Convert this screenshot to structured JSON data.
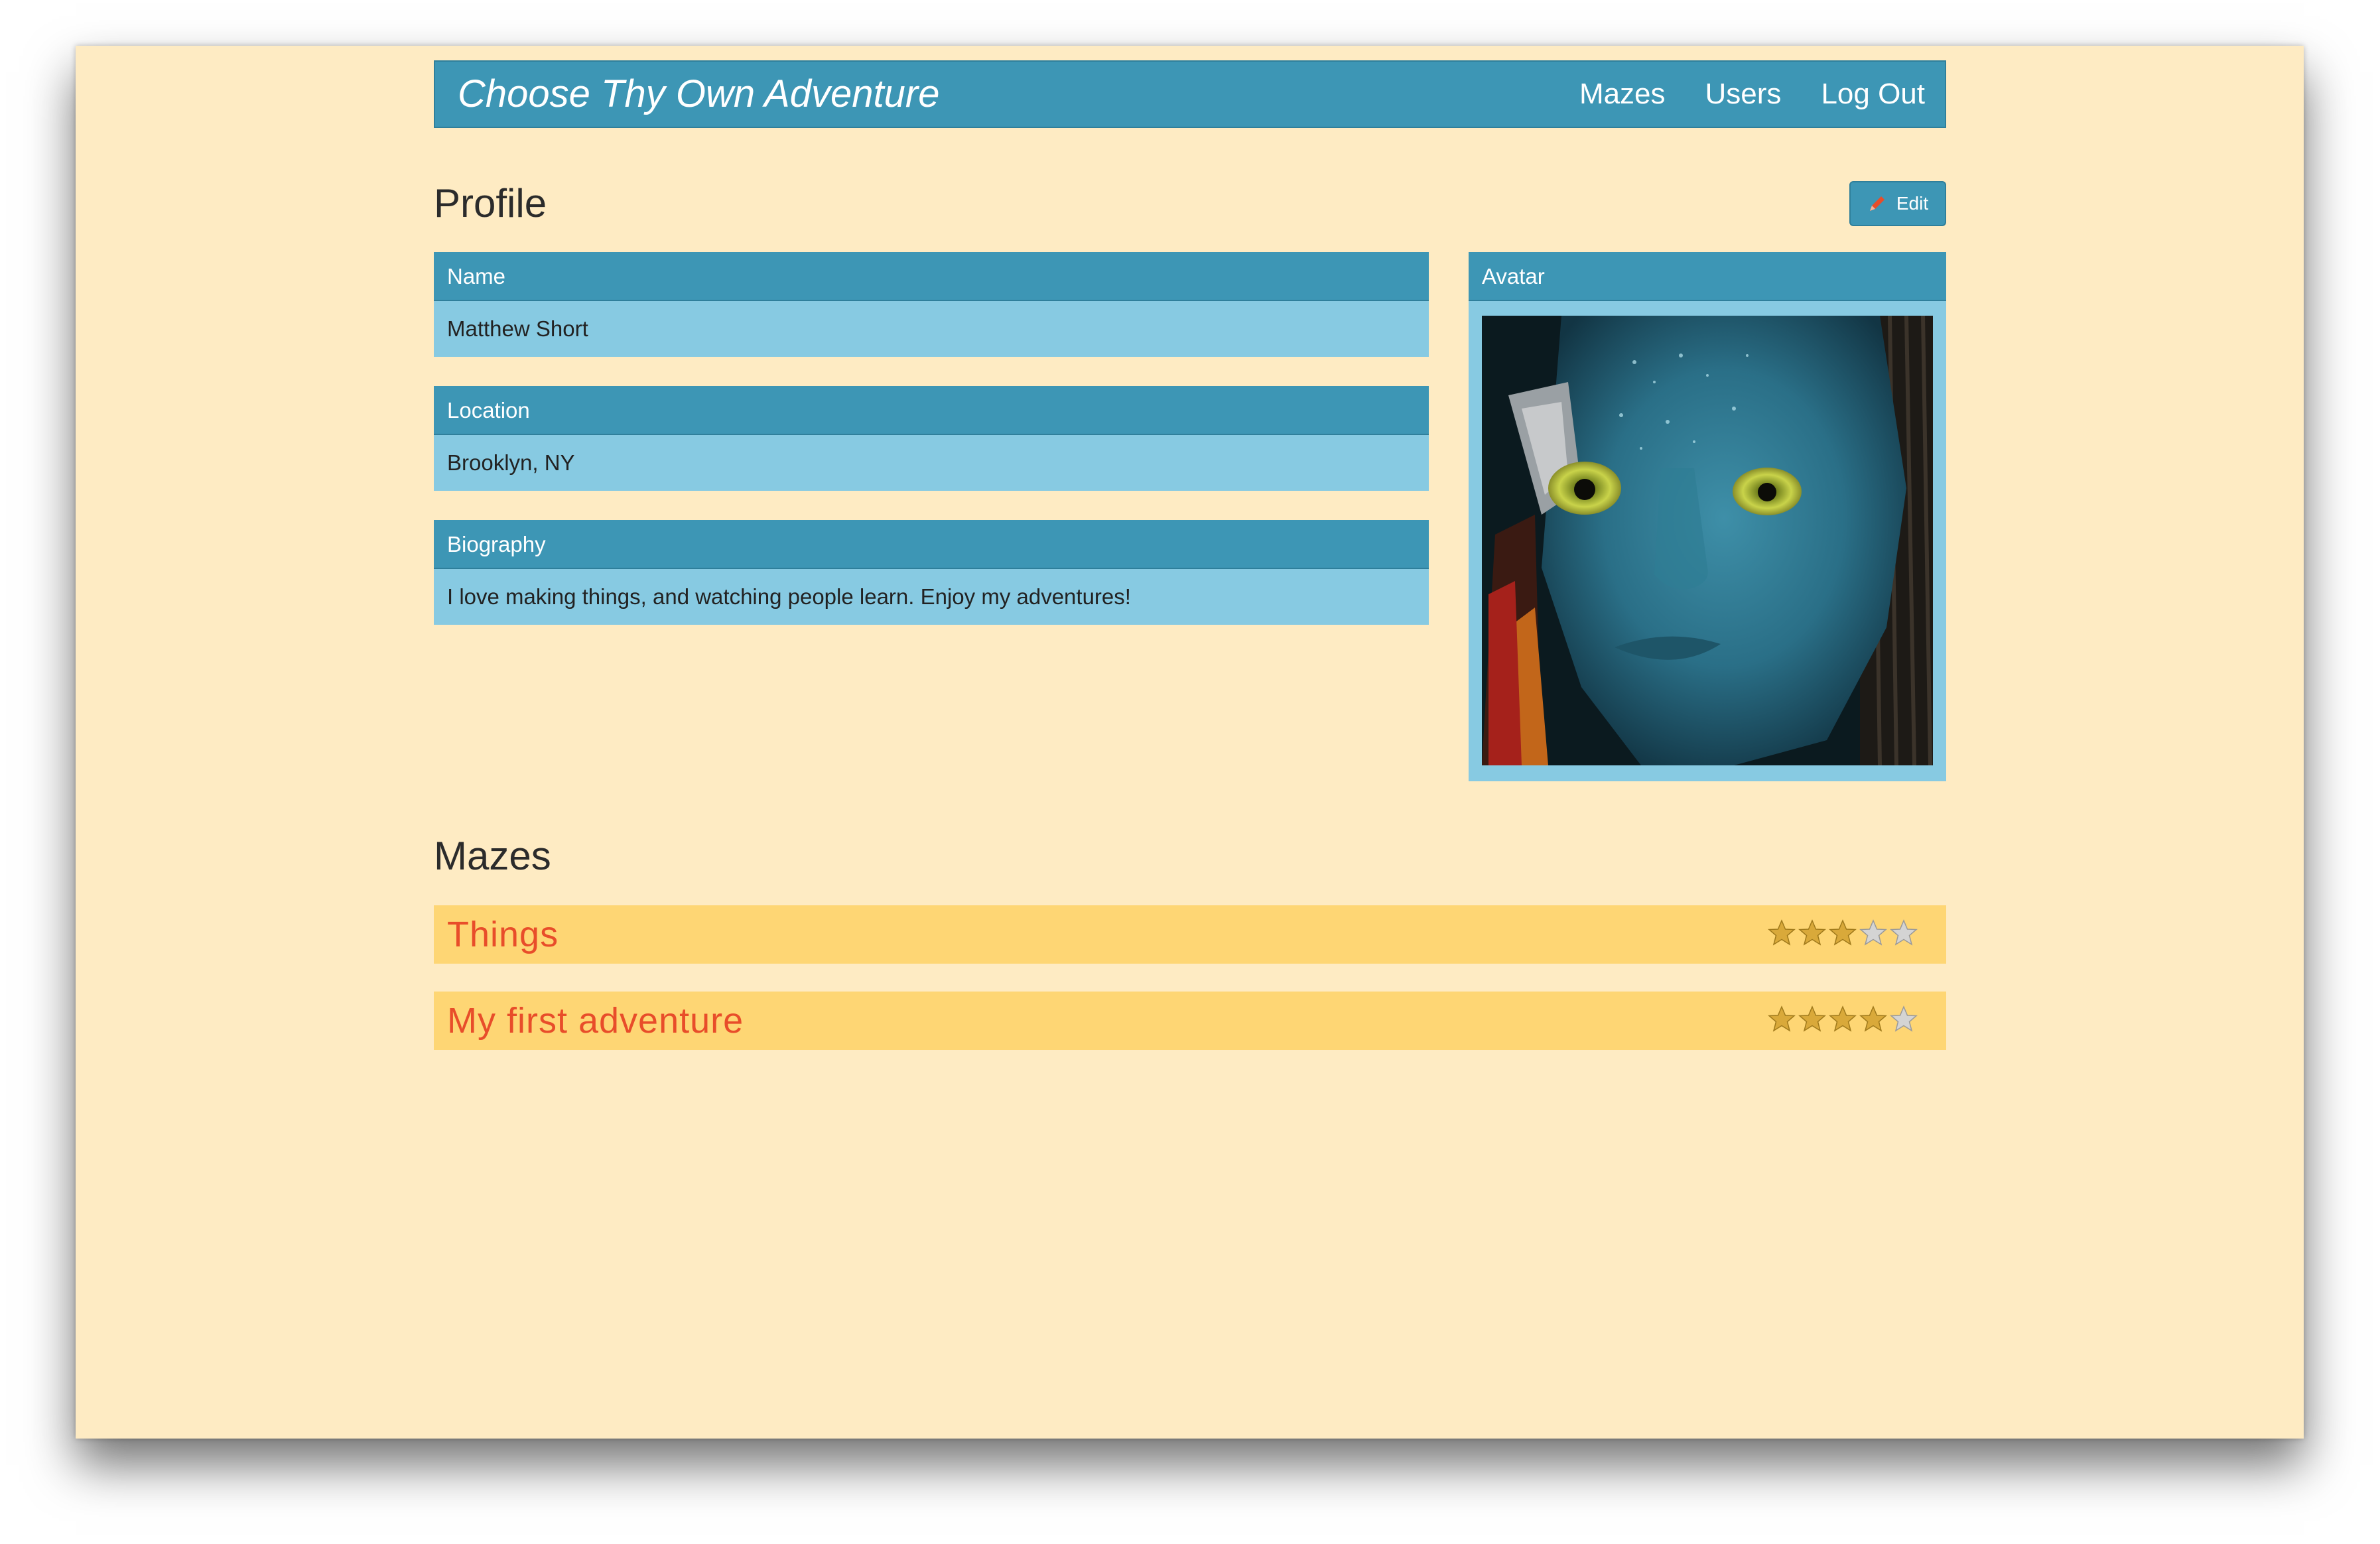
{
  "nav": {
    "brand": "Choose Thy Own Adventure",
    "links": [
      "Mazes",
      "Users",
      "Log Out"
    ]
  },
  "profile": {
    "heading": "Profile",
    "edit_label": "Edit",
    "fields": [
      {
        "label": "Name",
        "value": "Matthew Short"
      },
      {
        "label": "Location",
        "value": "Brooklyn, NY"
      },
      {
        "label": "Biography",
        "value": "I love making things, and watching people learn. Enjoy my adventures!"
      }
    ],
    "avatar_label": "Avatar"
  },
  "mazes": {
    "heading": "Mazes",
    "items": [
      {
        "title": "Things",
        "rating": 3,
        "max_rating": 5
      },
      {
        "title": "My first adventure",
        "rating": 4,
        "max_rating": 5
      }
    ]
  },
  "colors": {
    "background": "#feebc3",
    "primary": "#3d96b5",
    "panel_body": "#87cae2",
    "maze_row": "#fed674",
    "maze_title": "#e84d2a",
    "star_filled": "#d9a93a",
    "star_empty": "#d4d4d4"
  }
}
